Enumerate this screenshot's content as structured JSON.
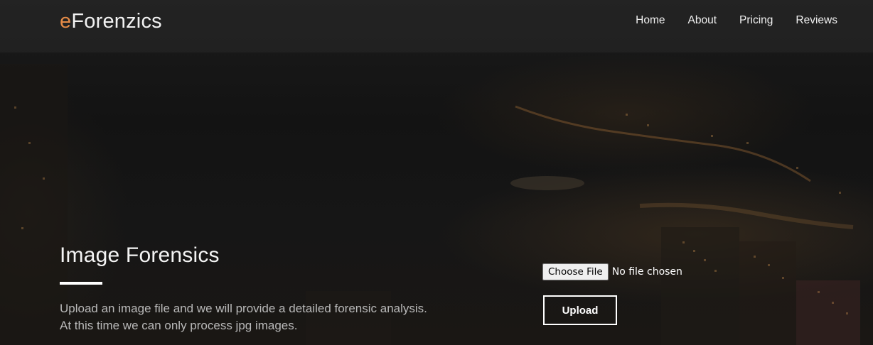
{
  "brand": {
    "accent": "e",
    "rest": "Forenzics",
    "accent_color": "#e58b47"
  },
  "nav": {
    "items": [
      {
        "label": "Home"
      },
      {
        "label": "About"
      },
      {
        "label": "Pricing"
      },
      {
        "label": "Reviews"
      }
    ]
  },
  "hero": {
    "title": "Image Forensics",
    "line1": "Upload an image file and we will provide a detailed forensic analysis.",
    "line2": "At this time we can only process jpg images."
  },
  "upload": {
    "choose_label": "Choose File",
    "status": "No file chosen",
    "submit_label": "Upload"
  }
}
